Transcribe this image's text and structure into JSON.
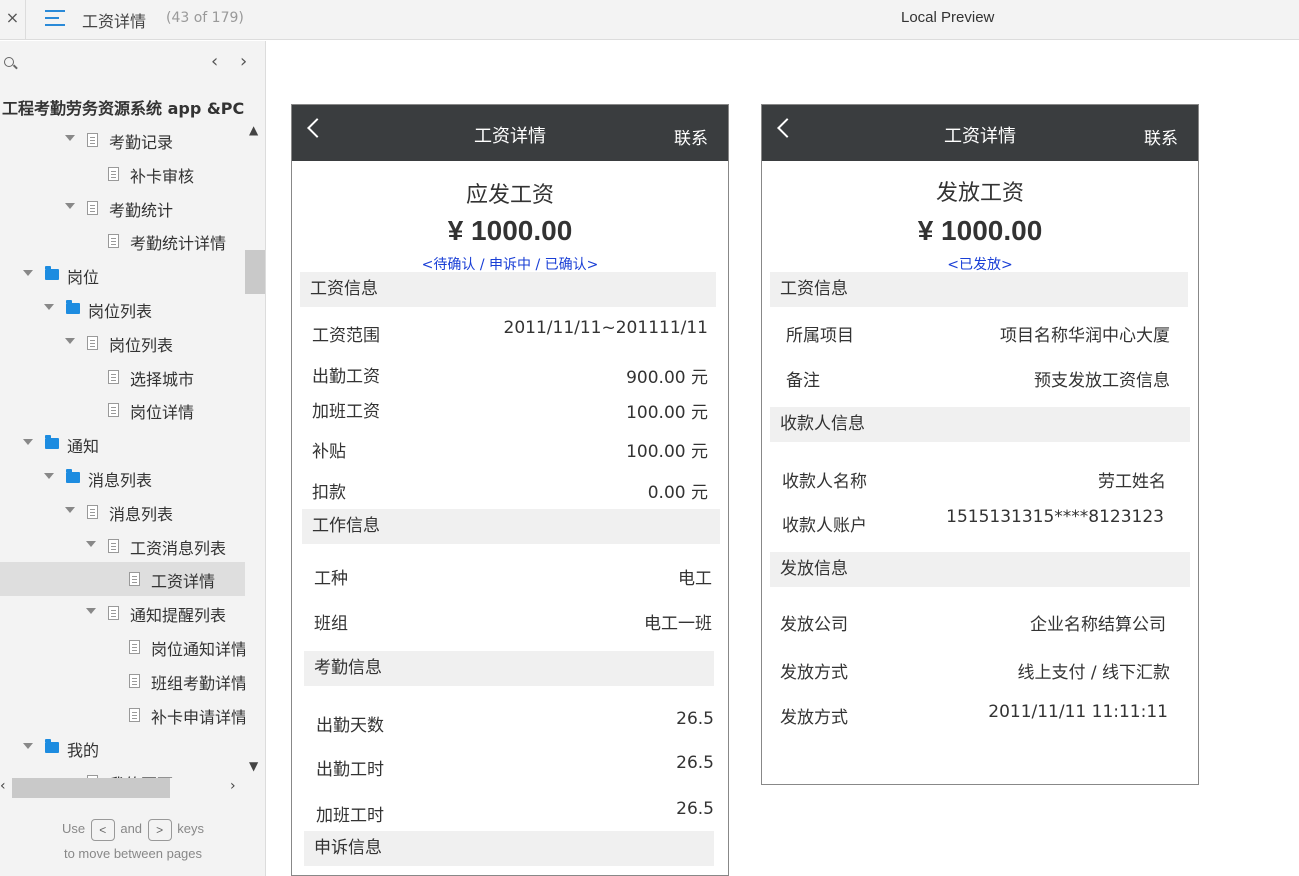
{
  "topbar": {
    "close": "×",
    "title": "工资详情",
    "count": "(43 of 179)",
    "preview": "Local Preview"
  },
  "sidebar": {
    "project_title": "工程考勤劳务资源系统 app &PC",
    "tree": [
      {
        "label": "考勤记录",
        "type": "doc",
        "caret": true
      },
      {
        "label": "补卡审核",
        "type": "doc",
        "caret": false
      },
      {
        "label": "考勤统计",
        "type": "doc",
        "caret": true
      },
      {
        "label": "考勤统计详情",
        "type": "doc",
        "caret": false
      },
      {
        "label": "岗位",
        "type": "folder",
        "caret": true
      },
      {
        "label": "岗位列表",
        "type": "folder",
        "caret": true
      },
      {
        "label": "岗位列表",
        "type": "doc",
        "caret": true
      },
      {
        "label": "选择城市",
        "type": "doc",
        "caret": false
      },
      {
        "label": "岗位详情",
        "type": "doc",
        "caret": false
      },
      {
        "label": "通知",
        "type": "folder",
        "caret": true
      },
      {
        "label": "消息列表",
        "type": "folder",
        "caret": true
      },
      {
        "label": "消息列表",
        "type": "doc",
        "caret": true
      },
      {
        "label": "工资消息列表",
        "type": "doc",
        "caret": true
      },
      {
        "label": "工资详情",
        "type": "doc",
        "caret": false,
        "active": true
      },
      {
        "label": "通知提醒列表",
        "type": "doc",
        "caret": true
      },
      {
        "label": "岗位通知详情",
        "type": "doc",
        "caret": false
      },
      {
        "label": "班组考勤详情",
        "type": "doc",
        "caret": false
      },
      {
        "label": "补卡申请详情",
        "type": "doc",
        "caret": false
      },
      {
        "label": "我的",
        "type": "folder",
        "caret": true
      },
      {
        "label": "我的页面",
        "type": "doc",
        "caret": false
      }
    ],
    "hint_use": "Use",
    "hint_and": "and",
    "hint_keys": "keys",
    "hint_line2": "to move between pages",
    "key_left": "<",
    "key_right": ">"
  },
  "phone_left": {
    "title": "工资详情",
    "contact": "联系",
    "amount_label": "应发工资",
    "amount": "¥ 1000.00",
    "status": "<待确认 / 申诉中 / 已确认>",
    "sections": {
      "salary": "工资信息",
      "work": "工作信息",
      "attendance": "考勤信息",
      "appeal": "申诉信息"
    },
    "rows": {
      "range_label": "工资范围",
      "range_value": "2011/11/11~201111/11",
      "attend_pay_label": "出勤工资",
      "attend_pay_value": "900.00 元",
      "overtime_pay_label": "加班工资",
      "overtime_pay_value": "100.00 元",
      "subsidy_label": "补贴",
      "subsidy_value": "100.00 元",
      "deduct_label": "扣款",
      "deduct_value": "0.00 元",
      "worktype_label": "工种",
      "worktype_value": "电工",
      "team_label": "班组",
      "team_value": "电工一班",
      "days_label": "出勤天数",
      "days_value": "26.5",
      "hours_label": "出勤工时",
      "hours_value": "26.5",
      "ot_hours_label": "加班工时",
      "ot_hours_value": "26.5"
    }
  },
  "phone_right": {
    "title": "工资详情",
    "contact": "联系",
    "amount_label": "发放工资",
    "amount": "¥ 1000.00",
    "status": "<已发放>",
    "sections": {
      "salary": "工资信息",
      "payee": "收款人信息",
      "payout": "发放信息"
    },
    "rows": {
      "project_label": "所属项目",
      "project_value": "项目名称华润中心大厦",
      "remark_label": "备注",
      "remark_value": "预支发放工资信息",
      "payee_name_label": "收款人名称",
      "payee_name_value": "劳工姓名",
      "payee_account_label": "收款人账户",
      "payee_account_value": "1515131315****8123123",
      "company_label": "发放公司",
      "company_value": "企业名称结算公司",
      "method_label": "发放方式",
      "method_value": "线上支付 / 线下汇款",
      "time_label": "发放方式",
      "time_value": "2011/11/11 11:11:11"
    }
  }
}
